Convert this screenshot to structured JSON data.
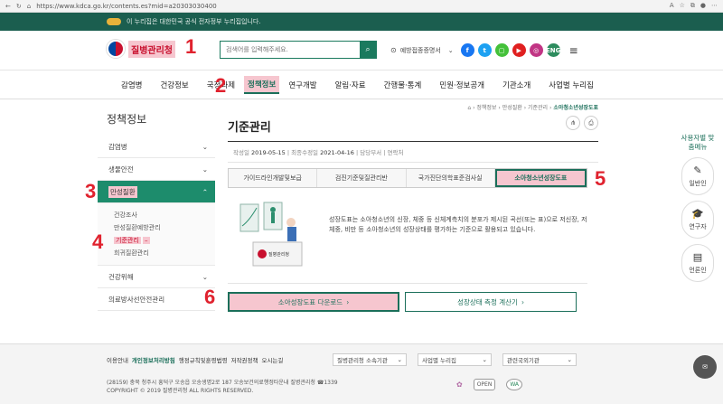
{
  "browser": {
    "url": "https://www.kdca.go.kr/contents.es?mid=a20303030400"
  },
  "gov_banner": {
    "text": "이 누리집은 대한민국 공식 전자정부 누리집입니다."
  },
  "logo": {
    "text": "질병관리청"
  },
  "annotations": [
    "1",
    "2",
    "3",
    "4",
    "5",
    "6"
  ],
  "search": {
    "placeholder": "검색어를 입력해주세요."
  },
  "header": {
    "vaccination_label": "예방접종증명서",
    "lang": "ENG"
  },
  "gnb": [
    "감염병",
    "건강정보",
    "국정과제",
    "정책정보",
    "연구개발",
    "알림·자료",
    "간행물·통계",
    "민원·정보공개",
    "기관소개",
    "사업별 누리집"
  ],
  "lnb": {
    "title": "정책정보",
    "items": [
      "감염병",
      "생물안전",
      "만성질환",
      "건강위해",
      "의료방사선안전관리"
    ],
    "sub": [
      "건강조사",
      "만성질환예방관리",
      "기준관리",
      "희귀질환관리"
    ]
  },
  "breadcrumb": [
    "정책정보",
    "만성질환",
    "기준관리",
    "소아청소년성장도표"
  ],
  "page_title": "기준관리",
  "meta": {
    "created_label": "작성일",
    "created": "2019-05-15",
    "modified_label": "최종수정일",
    "modified": "2021-04-16",
    "dept_label": "담당부서",
    "contact_label": "연락처"
  },
  "tabs": [
    "가이드라인개발및보급",
    "검진기준및질관리반",
    "국가진단의학표준검사실",
    "소아청소년성장도표"
  ],
  "description": "성장도표는 소아청소년의 신장, 체중 등 신체계측치의 분포가 제시된 곡선(또는 표)으로 저신장, 저체중, 비만 등 소아청소년의 성장상태를 평가하는 기준으로 활용되고 있습니다.",
  "illustration_label": "질병관리청",
  "buttons": {
    "download": "소아성장도표 다운로드",
    "calculator": "성장상태 측정 계산기"
  },
  "side_quick": {
    "title": "사용자별 맞춤메뉴",
    "items": [
      "일반인",
      "연구자",
      "언론인"
    ]
  },
  "footer": {
    "links": [
      "이용안내",
      "개인정보처리방침",
      "행정규칙및훈령법령",
      "저작권정책",
      "오시는길"
    ],
    "selects": [
      "질병관리청 소속기관",
      "사업별 누리집",
      "관련국외기관"
    ],
    "address": "(28159) 충북 청주시 흥덕구 오송읍 오송생명2로 187 오송보건의료행정타운내 질병관리청 ☎1339",
    "copyright": "COPYRIGHT © 2019 질병관리청 ALL RIGHTS RESERVED.",
    "badges": [
      "OPEN",
      "WA"
    ]
  },
  "colors": {
    "brand": "#1b6f5a",
    "highlight": "#f6c6cf",
    "annotation": "#e0222e"
  }
}
